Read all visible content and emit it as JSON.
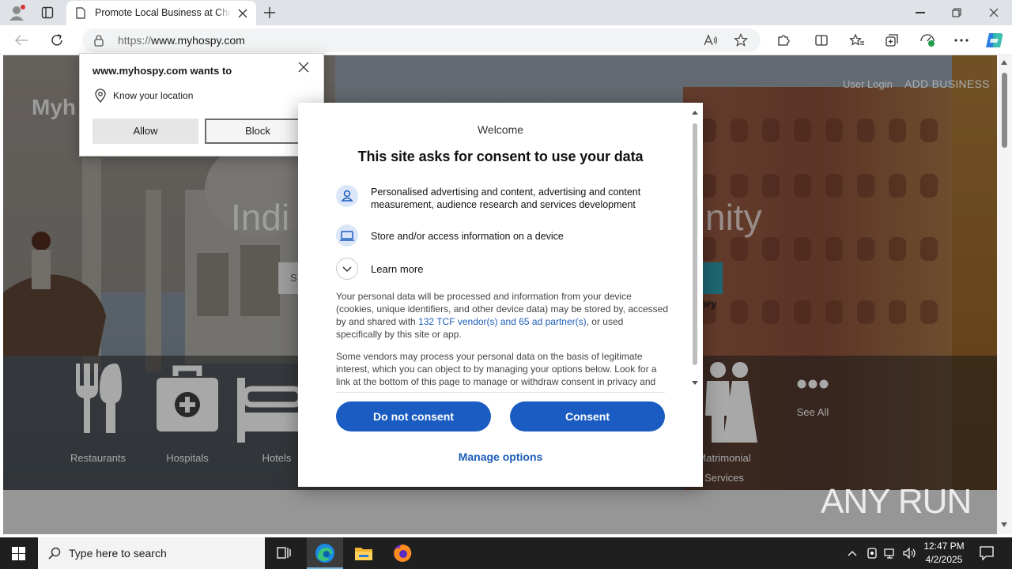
{
  "browser": {
    "tab_title": "Promote Local Business at Cheap",
    "url_scheme": "https://",
    "url_host": "www.myhospy.com"
  },
  "site": {
    "logo": "Myh",
    "nav_login": "User Login",
    "nav_add": "ADD BUSINESS",
    "hero_left": "Indi",
    "hero_right": "nity",
    "search_stub": "S",
    "tag_stub": "ory",
    "categories": [
      {
        "label": "Restaurants",
        "icon": "fork-knife-icon"
      },
      {
        "label": "Hospitals",
        "icon": "medical-kit-icon"
      },
      {
        "label": "Hotels",
        "icon": "bed-icon"
      },
      {
        "label": "Matrimonial",
        "icon": "couple-icon"
      },
      {
        "label": "Services",
        "icon": "couple-icon"
      }
    ],
    "see_all": "See All"
  },
  "permission": {
    "title": "www.myhospy.com wants to",
    "item": "Know your location",
    "allow": "Allow",
    "block": "Block"
  },
  "consent": {
    "welcome": "Welcome",
    "title": "This site asks for consent to use your data",
    "purpose1": "Personalised advertising and content, advertising and content measurement, audience research and services development",
    "purpose2": "Store and/or access information on a device",
    "learn_more": "Learn more",
    "para1_a": "Your personal data will be processed and information from your device (cookies, unique identifiers, and other device data) may be stored by, accessed by and shared with ",
    "para1_link": "132 TCF vendor(s) and 65 ad partner(s)",
    "para1_b": ", or used specifically by this site or app.",
    "para2": "Some vendors may process your personal data on the basis of legitimate interest, which you can object to by managing your options below. Look for a link at the bottom of this page to manage or withdraw consent in privacy and cookie settings.",
    "do_not_consent": "Do not consent",
    "consent": "Consent",
    "manage": "Manage options"
  },
  "taskbar": {
    "search_placeholder": "Type here to search",
    "time": "12:47 PM",
    "date": "4/2/2025"
  },
  "watermark": "ANY RUN",
  "colors": {
    "accent": "#1a5cc1",
    "link": "#1d5db8",
    "taskbar": "#1f1f1f"
  }
}
